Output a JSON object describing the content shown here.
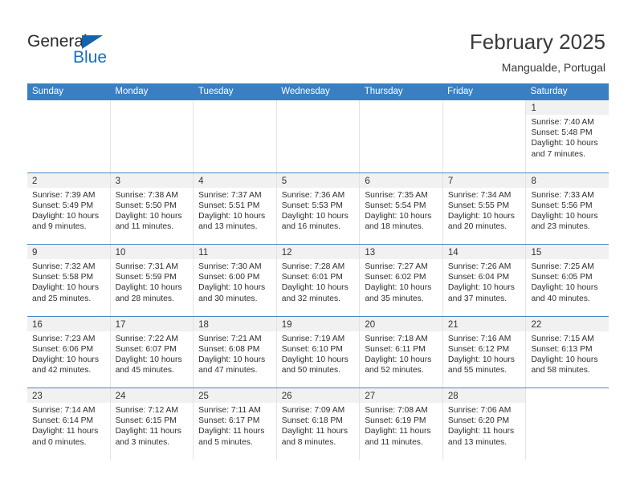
{
  "brand": {
    "name_part1": "General",
    "name_part2": "Blue",
    "accent_color": "#1670c0",
    "triangle_color": "#1263b0"
  },
  "header": {
    "title": "February 2025",
    "subtitle": "Mangualde, Portugal"
  },
  "theme": {
    "header_row_color": "#3a7fc2",
    "daynum_band_color": "#f1f1f1",
    "row_divider_color": "#4a86c5"
  },
  "weekdays": [
    "Sunday",
    "Monday",
    "Tuesday",
    "Wednesday",
    "Thursday",
    "Friday",
    "Saturday"
  ],
  "weeks": [
    [
      {
        "day": ""
      },
      {
        "day": ""
      },
      {
        "day": ""
      },
      {
        "day": ""
      },
      {
        "day": ""
      },
      {
        "day": ""
      },
      {
        "day": "1",
        "sunrise": "Sunrise: 7:40 AM",
        "sunset": "Sunset: 5:48 PM",
        "daylight_l1": "Daylight: 10 hours",
        "daylight_l2": "and 7 minutes."
      }
    ],
    [
      {
        "day": "2",
        "sunrise": "Sunrise: 7:39 AM",
        "sunset": "Sunset: 5:49 PM",
        "daylight_l1": "Daylight: 10 hours",
        "daylight_l2": "and 9 minutes."
      },
      {
        "day": "3",
        "sunrise": "Sunrise: 7:38 AM",
        "sunset": "Sunset: 5:50 PM",
        "daylight_l1": "Daylight: 10 hours",
        "daylight_l2": "and 11 minutes."
      },
      {
        "day": "4",
        "sunrise": "Sunrise: 7:37 AM",
        "sunset": "Sunset: 5:51 PM",
        "daylight_l1": "Daylight: 10 hours",
        "daylight_l2": "and 13 minutes."
      },
      {
        "day": "5",
        "sunrise": "Sunrise: 7:36 AM",
        "sunset": "Sunset: 5:53 PM",
        "daylight_l1": "Daylight: 10 hours",
        "daylight_l2": "and 16 minutes."
      },
      {
        "day": "6",
        "sunrise": "Sunrise: 7:35 AM",
        "sunset": "Sunset: 5:54 PM",
        "daylight_l1": "Daylight: 10 hours",
        "daylight_l2": "and 18 minutes."
      },
      {
        "day": "7",
        "sunrise": "Sunrise: 7:34 AM",
        "sunset": "Sunset: 5:55 PM",
        "daylight_l1": "Daylight: 10 hours",
        "daylight_l2": "and 20 minutes."
      },
      {
        "day": "8",
        "sunrise": "Sunrise: 7:33 AM",
        "sunset": "Sunset: 5:56 PM",
        "daylight_l1": "Daylight: 10 hours",
        "daylight_l2": "and 23 minutes."
      }
    ],
    [
      {
        "day": "9",
        "sunrise": "Sunrise: 7:32 AM",
        "sunset": "Sunset: 5:58 PM",
        "daylight_l1": "Daylight: 10 hours",
        "daylight_l2": "and 25 minutes."
      },
      {
        "day": "10",
        "sunrise": "Sunrise: 7:31 AM",
        "sunset": "Sunset: 5:59 PM",
        "daylight_l1": "Daylight: 10 hours",
        "daylight_l2": "and 28 minutes."
      },
      {
        "day": "11",
        "sunrise": "Sunrise: 7:30 AM",
        "sunset": "Sunset: 6:00 PM",
        "daylight_l1": "Daylight: 10 hours",
        "daylight_l2": "and 30 minutes."
      },
      {
        "day": "12",
        "sunrise": "Sunrise: 7:28 AM",
        "sunset": "Sunset: 6:01 PM",
        "daylight_l1": "Daylight: 10 hours",
        "daylight_l2": "and 32 minutes."
      },
      {
        "day": "13",
        "sunrise": "Sunrise: 7:27 AM",
        "sunset": "Sunset: 6:02 PM",
        "daylight_l1": "Daylight: 10 hours",
        "daylight_l2": "and 35 minutes."
      },
      {
        "day": "14",
        "sunrise": "Sunrise: 7:26 AM",
        "sunset": "Sunset: 6:04 PM",
        "daylight_l1": "Daylight: 10 hours",
        "daylight_l2": "and 37 minutes."
      },
      {
        "day": "15",
        "sunrise": "Sunrise: 7:25 AM",
        "sunset": "Sunset: 6:05 PM",
        "daylight_l1": "Daylight: 10 hours",
        "daylight_l2": "and 40 minutes."
      }
    ],
    [
      {
        "day": "16",
        "sunrise": "Sunrise: 7:23 AM",
        "sunset": "Sunset: 6:06 PM",
        "daylight_l1": "Daylight: 10 hours",
        "daylight_l2": "and 42 minutes."
      },
      {
        "day": "17",
        "sunrise": "Sunrise: 7:22 AM",
        "sunset": "Sunset: 6:07 PM",
        "daylight_l1": "Daylight: 10 hours",
        "daylight_l2": "and 45 minutes."
      },
      {
        "day": "18",
        "sunrise": "Sunrise: 7:21 AM",
        "sunset": "Sunset: 6:08 PM",
        "daylight_l1": "Daylight: 10 hours",
        "daylight_l2": "and 47 minutes."
      },
      {
        "day": "19",
        "sunrise": "Sunrise: 7:19 AM",
        "sunset": "Sunset: 6:10 PM",
        "daylight_l1": "Daylight: 10 hours",
        "daylight_l2": "and 50 minutes."
      },
      {
        "day": "20",
        "sunrise": "Sunrise: 7:18 AM",
        "sunset": "Sunset: 6:11 PM",
        "daylight_l1": "Daylight: 10 hours",
        "daylight_l2": "and 52 minutes."
      },
      {
        "day": "21",
        "sunrise": "Sunrise: 7:16 AM",
        "sunset": "Sunset: 6:12 PM",
        "daylight_l1": "Daylight: 10 hours",
        "daylight_l2": "and 55 minutes."
      },
      {
        "day": "22",
        "sunrise": "Sunrise: 7:15 AM",
        "sunset": "Sunset: 6:13 PM",
        "daylight_l1": "Daylight: 10 hours",
        "daylight_l2": "and 58 minutes."
      }
    ],
    [
      {
        "day": "23",
        "sunrise": "Sunrise: 7:14 AM",
        "sunset": "Sunset: 6:14 PM",
        "daylight_l1": "Daylight: 11 hours",
        "daylight_l2": "and 0 minutes."
      },
      {
        "day": "24",
        "sunrise": "Sunrise: 7:12 AM",
        "sunset": "Sunset: 6:15 PM",
        "daylight_l1": "Daylight: 11 hours",
        "daylight_l2": "and 3 minutes."
      },
      {
        "day": "25",
        "sunrise": "Sunrise: 7:11 AM",
        "sunset": "Sunset: 6:17 PM",
        "daylight_l1": "Daylight: 11 hours",
        "daylight_l2": "and 5 minutes."
      },
      {
        "day": "26",
        "sunrise": "Sunrise: 7:09 AM",
        "sunset": "Sunset: 6:18 PM",
        "daylight_l1": "Daylight: 11 hours",
        "daylight_l2": "and 8 minutes."
      },
      {
        "day": "27",
        "sunrise": "Sunrise: 7:08 AM",
        "sunset": "Sunset: 6:19 PM",
        "daylight_l1": "Daylight: 11 hours",
        "daylight_l2": "and 11 minutes."
      },
      {
        "day": "28",
        "sunrise": "Sunrise: 7:06 AM",
        "sunset": "Sunset: 6:20 PM",
        "daylight_l1": "Daylight: 11 hours",
        "daylight_l2": "and 13 minutes."
      },
      {
        "day": ""
      }
    ]
  ]
}
